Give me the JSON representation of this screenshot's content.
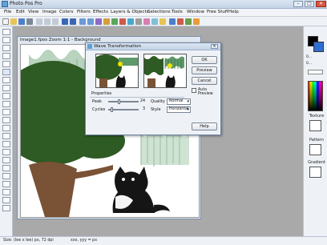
{
  "app": {
    "title": "Photo Pos Pro"
  },
  "window_controls": {
    "minimize": "–",
    "maximize": "□",
    "close": "✕"
  },
  "menu": [
    "File",
    "Edit",
    "View",
    "Image",
    "Colors",
    "Filters",
    "Effects",
    "Layers & Objects",
    "Selections",
    "Tools",
    "Window",
    "Free Stuff",
    "Help"
  ],
  "image_window": {
    "title": "Image1.fpos   Zoom  1:1 - Background"
  },
  "dialog": {
    "title": "Wave Transformation",
    "close": "✕",
    "ok": "OK",
    "preview": "Preview",
    "cancel": "Cancel",
    "auto_preview": "Auto Preview",
    "properties": "Properties",
    "peak_label": "Peak",
    "peak_value": "24",
    "cycles_label": "Cycles",
    "cycles_value": "3",
    "quality_label": "Quality",
    "quality_value": "Normal",
    "style_label": "Style",
    "style_value": "Horizontal",
    "help": "Help"
  },
  "right_panel": {
    "mode_labels": [
      "0...",
      "0..."
    ],
    "texture": "Texture",
    "pattern": "Pattern",
    "gradient": "Gradient"
  },
  "status": {
    "size": "Size: (Iee x Iee) px, 72 dpi",
    "coords": "xxx, yyy = px"
  },
  "colors": {
    "accent": "#2f6fd1",
    "tree_green": "#2e5a23",
    "trunk": "#7a5236",
    "cat": "#151515"
  }
}
